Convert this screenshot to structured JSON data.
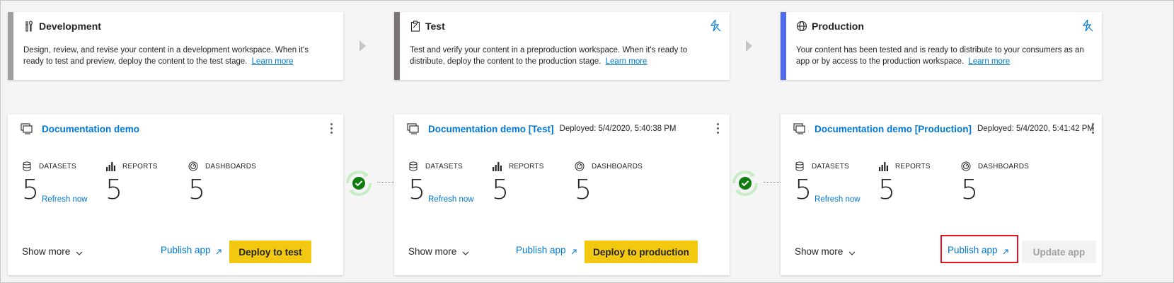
{
  "colors": {
    "accent": "#0078d4",
    "deploy_yellow": "#f2c811",
    "success_green": "#107c10",
    "dev_bar": "#a19f9d",
    "test_bar": "#7a7574",
    "prod_bar": "#4f6bed",
    "highlight_red": "#e81123"
  },
  "stages": [
    {
      "title": "Development",
      "icon": "tools-icon",
      "description": "Design, review, and revise your content in a development workspace. When it's ready to test and preview, deploy the content to the test stage.",
      "learn_more": "Learn more",
      "has_rules_icon": false
    },
    {
      "title": "Test",
      "icon": "clipboard-icon",
      "description": "Test and verify your content in a preproduction workspace. When it's ready to distribute, deploy the content to the production stage.",
      "learn_more": "Learn more",
      "has_rules_icon": true
    },
    {
      "title": "Production",
      "icon": "globe-icon",
      "description": "Your content has been tested and is ready to distribute to your consumers as an app or by access to the production workspace.",
      "learn_more": "Learn more",
      "has_rules_icon": true
    }
  ],
  "workspaces": [
    {
      "name": "Documentation demo",
      "deployed": "",
      "metrics": [
        {
          "label": "DATASETS",
          "value": "5",
          "icon": "database-icon"
        },
        {
          "label": "REPORTS",
          "value": "5",
          "icon": "bar-chart-icon"
        },
        {
          "label": "DASHBOARDS",
          "value": "5",
          "icon": "gauge-icon"
        }
      ],
      "refresh": "Refresh now",
      "show_more": "Show more",
      "publish": "Publish app",
      "action": "Deploy to test"
    },
    {
      "name": "Documentation demo [Test]",
      "deployed": "Deployed: 5/4/2020, 5:40:38 PM",
      "metrics": [
        {
          "label": "DATASETS",
          "value": "5",
          "icon": "database-icon"
        },
        {
          "label": "REPORTS",
          "value": "5",
          "icon": "bar-chart-icon"
        },
        {
          "label": "DASHBOARDS",
          "value": "5",
          "icon": "gauge-icon"
        }
      ],
      "refresh": "Refresh now",
      "show_more": "Show more",
      "publish": "Publish app",
      "action": "Deploy to production"
    },
    {
      "name": "Documentation demo [Production]",
      "deployed": "Deployed: 5/4/2020, 5:41:42 PM",
      "metrics": [
        {
          "label": "DATASETS",
          "value": "5",
          "icon": "database-icon"
        },
        {
          "label": "REPORTS",
          "value": "5",
          "icon": "bar-chart-icon"
        },
        {
          "label": "DASHBOARDS",
          "value": "5",
          "icon": "gauge-icon"
        }
      ],
      "refresh": "Refresh now",
      "show_more": "Show more",
      "publish": "Publish app",
      "action": "Update app"
    }
  ]
}
